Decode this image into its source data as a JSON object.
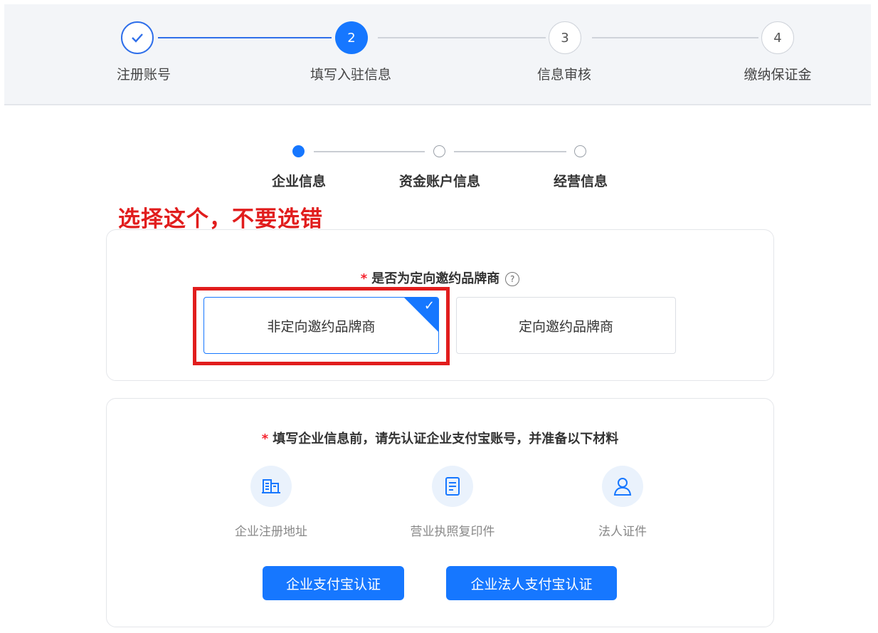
{
  "top_steps": [
    {
      "label": "注册账号",
      "number": "1",
      "status": "done"
    },
    {
      "label": "填写入驻信息",
      "number": "2",
      "status": "active"
    },
    {
      "label": "信息审核",
      "number": "3",
      "status": "todo"
    },
    {
      "label": "缴纳保证金",
      "number": "4",
      "status": "todo"
    }
  ],
  "sub_steps": [
    {
      "label": "企业信息",
      "status": "active"
    },
    {
      "label": "资金账户信息",
      "status": "todo"
    },
    {
      "label": "经营信息",
      "status": "todo"
    }
  ],
  "annotation": {
    "text": "选择这个，不要选错"
  },
  "brand_question": {
    "required_mark": "*",
    "label": "是否为定向邀约品牌商",
    "help_icon": "question-circle-icon",
    "options": [
      {
        "label": "非定向邀约品牌商",
        "selected": true
      },
      {
        "label": "定向邀约品牌商",
        "selected": false
      }
    ]
  },
  "materials": {
    "required_mark": "*",
    "title": "填写企业信息前，请先认证企业支付宝账号，并准备以下材料",
    "items": [
      {
        "label": "企业注册地址",
        "icon": "building-icon"
      },
      {
        "label": "营业执照复印件",
        "icon": "document-icon"
      },
      {
        "label": "法人证件",
        "icon": "user-icon"
      }
    ],
    "buttons": [
      {
        "label": "企业支付宝认证"
      },
      {
        "label": "企业法人支付宝认证"
      }
    ]
  },
  "colors": {
    "accent": "#1677ff",
    "annotation": "#e11d1d",
    "page_bg": "#f3f5f8"
  }
}
